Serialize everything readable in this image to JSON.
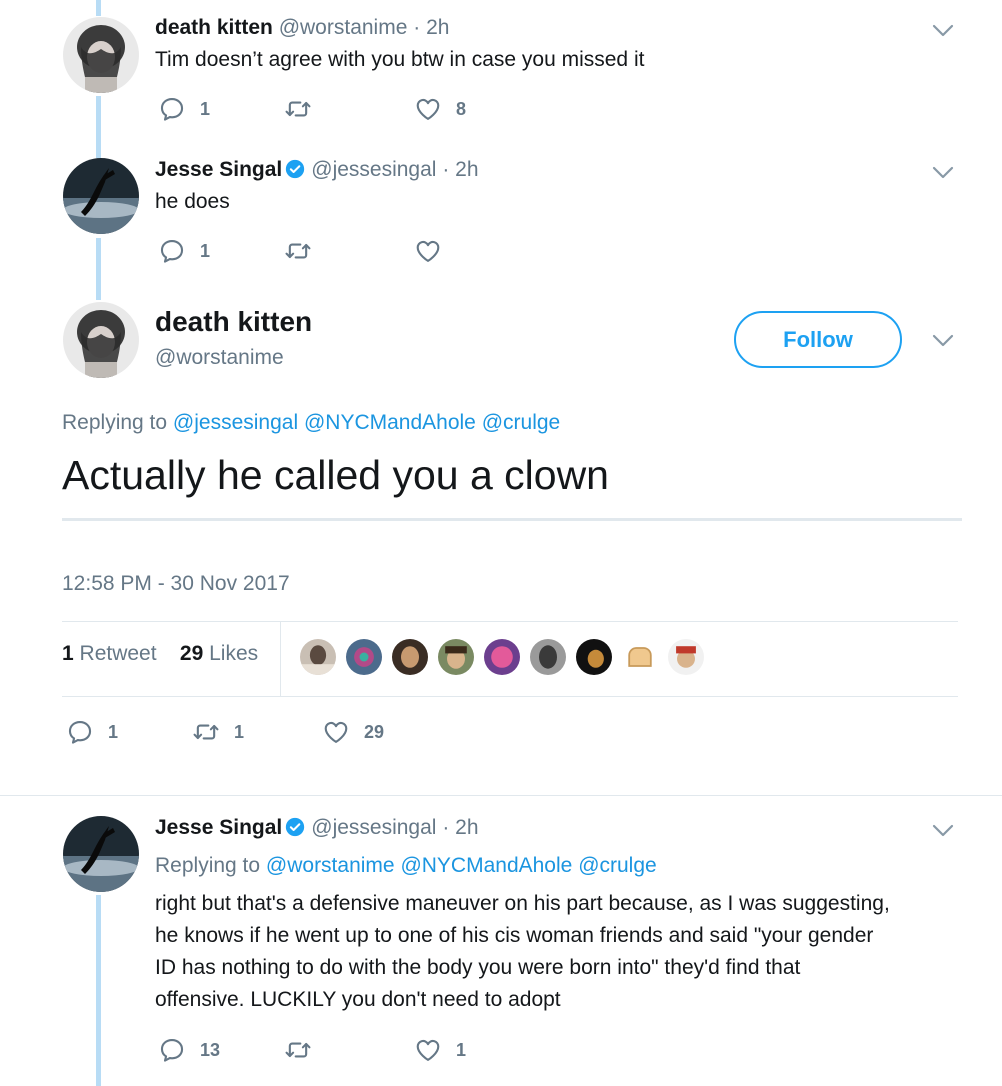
{
  "tweet1": {
    "name": "death kitten",
    "handle": "@worstanime",
    "dot": "·",
    "time": "2h",
    "text": "Tim doesn’t agree with you btw in case you missed it",
    "reply_count": "1",
    "retweet_count": "",
    "like_count": "8"
  },
  "tweet2": {
    "name": "Jesse Singal",
    "handle": "@jessesingal",
    "dot": "·",
    "time": "2h",
    "text": "he does",
    "reply_count": "1",
    "retweet_count": "",
    "like_count": ""
  },
  "main": {
    "name": "death kitten",
    "handle": "@worstanime",
    "follow_label": "Follow",
    "replying_prefix": "Replying to",
    "mentions": [
      "@jessesingal",
      "@NYCMandAhole",
      "@crulge"
    ],
    "text": "Actually he called you a clown",
    "timestamp": "12:58 PM - 30 Nov 2017",
    "retweets_num": "1",
    "retweets_label": "Retweet",
    "likes_num": "29",
    "likes_label": "Likes",
    "reply_count": "1",
    "retweet_count": "1",
    "like_count": "29"
  },
  "tweet4": {
    "name": "Jesse Singal",
    "handle": "@jessesingal",
    "dot": "·",
    "time": "2h",
    "replying_prefix": "Replying to",
    "mentions": [
      "@worstanime",
      "@NYCMandAhole",
      "@crulge"
    ],
    "lines": [
      "right but that's a defensive maneuver on his part because, as I was suggesting,",
      "he knows if he went up to one of his cis woman friends and said \"your gender",
      "ID has nothing to do with the body you were born into\" they'd find that",
      "offensive. LUCKILY you don't need to adopt"
    ],
    "reply_count": "13",
    "retweet_count": "",
    "like_count": "1"
  },
  "colors": {
    "link": "#1b95e0",
    "verified": "#1da1f2",
    "muted": "#657786",
    "thread_line": "#b8dcf5"
  },
  "icons": [
    "reply-icon",
    "retweet-icon",
    "heart-icon",
    "chevron-down-icon",
    "verified-badge-icon"
  ]
}
